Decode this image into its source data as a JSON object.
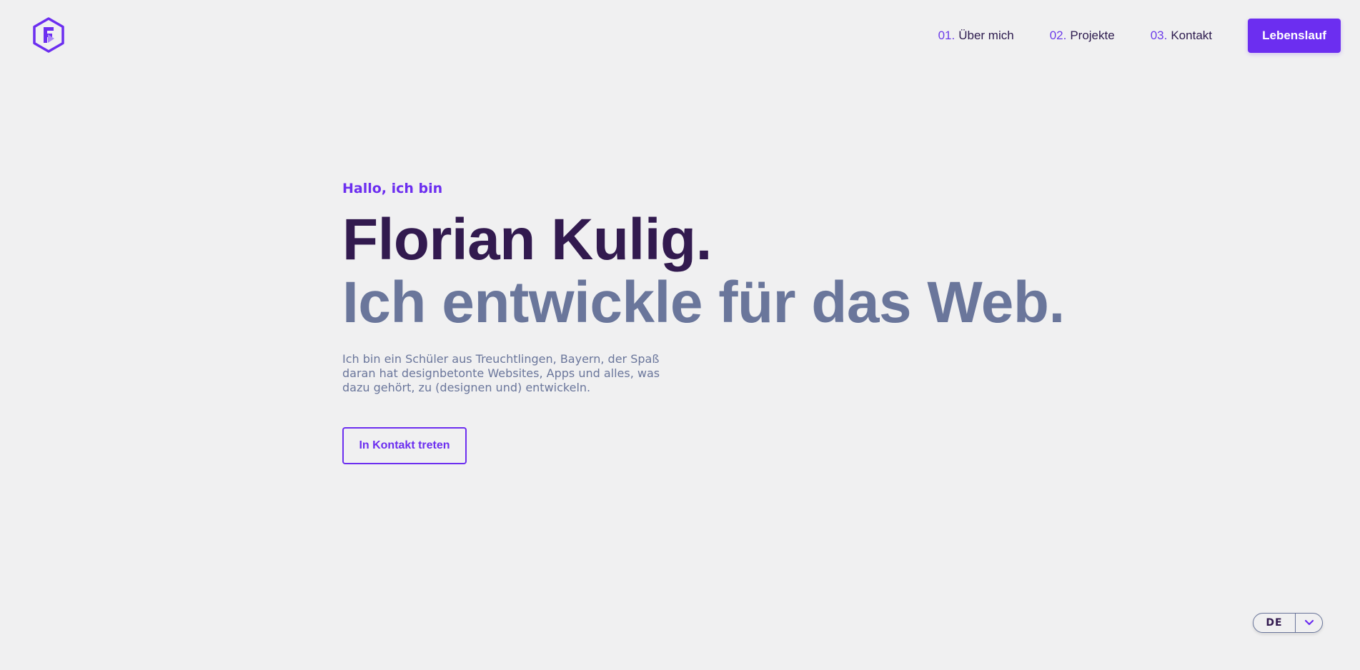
{
  "header": {
    "logo_icon": "hexagon-f-logo-icon",
    "nav": [
      {
        "number": "01.",
        "label": "Über mich"
      },
      {
        "number": "02.",
        "label": "Projekte"
      },
      {
        "number": "03.",
        "label": "Kontakt"
      }
    ],
    "cv_button_label": "Lebenslauf"
  },
  "hero": {
    "greeting": "Hallo, ich bin",
    "name": "Florian Kulig.",
    "tagline": "Ich entwickle für das Web.",
    "bio": "Ich bin ein Schüler aus Treuchtlingen, Bayern, der Spaß daran hat designbetonte Websites, Apps und alles, was dazu gehört, zu (designen und) entwickeln.",
    "contact_button_label": "In Kontakt treten"
  },
  "language_switcher": {
    "selected": "DE",
    "icon": "chevron-down-icon"
  },
  "colors": {
    "accent": "#6c2ef0",
    "heading": "#321a4f",
    "muted": "#6a769b",
    "background": "#f0f0f1"
  }
}
